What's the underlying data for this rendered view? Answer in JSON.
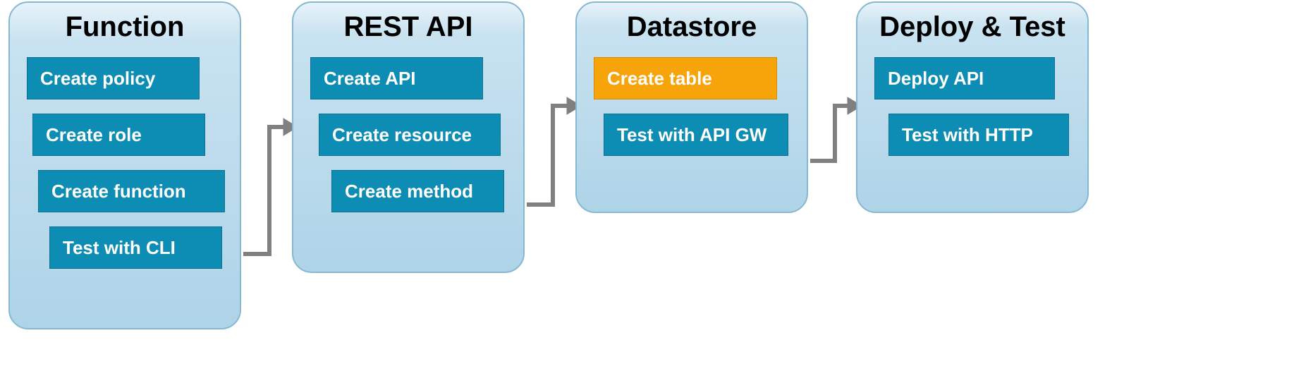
{
  "colors": {
    "card_border": "#86b8d0",
    "step_bg": "#0d8db3",
    "step_highlight": "#f7a30a",
    "arrow": "#808080"
  },
  "cards": {
    "function": {
      "title": "Function",
      "steps": [
        {
          "label": "Create policy"
        },
        {
          "label": "Create role"
        },
        {
          "label": "Create function"
        },
        {
          "label": "Test with CLI"
        }
      ]
    },
    "restapi": {
      "title": "REST API",
      "steps": [
        {
          "label": "Create API"
        },
        {
          "label": "Create resource"
        },
        {
          "label": "Create method"
        }
      ]
    },
    "datastore": {
      "title": "Datastore",
      "steps": [
        {
          "label": "Create table",
          "highlight": true
        },
        {
          "label": "Test with API GW"
        }
      ]
    },
    "deploy": {
      "title": "Deploy & Test",
      "steps": [
        {
          "label": "Deploy API"
        },
        {
          "label": "Test with HTTP"
        }
      ]
    }
  }
}
